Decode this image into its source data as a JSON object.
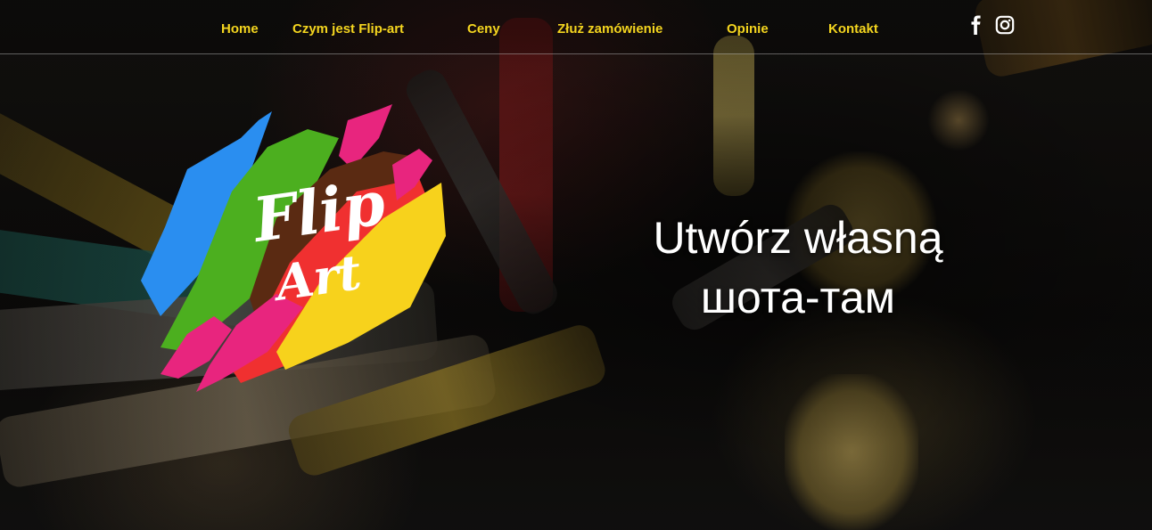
{
  "nav": {
    "items": [
      {
        "label": "Home"
      },
      {
        "label": "Czym jest Flip-art"
      },
      {
        "label": "Ceny"
      },
      {
        "label": "Złuż zamówienie"
      },
      {
        "label": "Opinie"
      },
      {
        "label": "Kontakt"
      }
    ],
    "social": [
      {
        "icon": "facebook-icon"
      },
      {
        "icon": "instagram-icon"
      }
    ]
  },
  "logo": {
    "line1": "Flip",
    "line2": "Art",
    "colors": [
      "#2a8ef0",
      "#4caf1f",
      "#e8257e",
      "#5a2a12",
      "#f03030",
      "#f7d21c"
    ]
  },
  "hero": {
    "line1": "Utwórz własną",
    "line2": "шота-там"
  },
  "colors": {
    "nav_text": "#f4d51f",
    "headline": "#ffffff"
  }
}
